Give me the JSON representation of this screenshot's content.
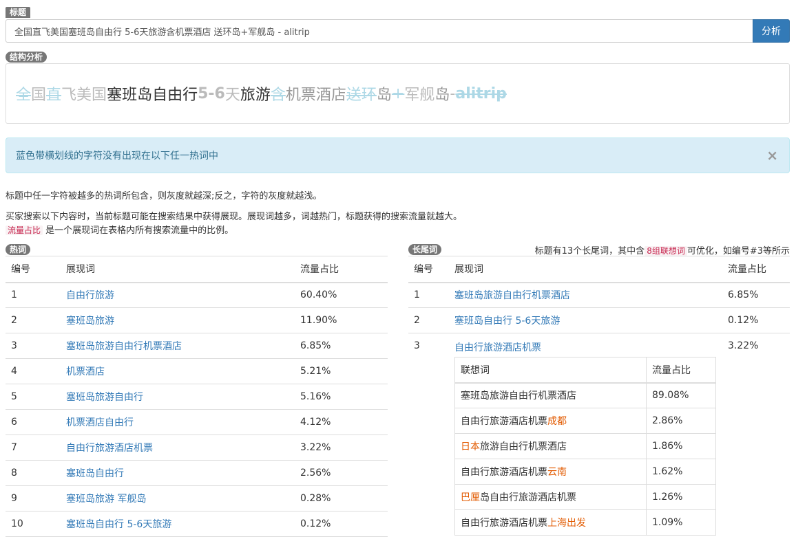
{
  "title_section": {
    "badge": "标题",
    "input_value": "全国直飞美国塞班岛自由行 5-6天旅游含机票酒店 送环岛+军舰岛 - alitrip",
    "analyze_button": "分析"
  },
  "structure": {
    "badge": "结构分析",
    "segments": [
      {
        "text": "全",
        "style": "s"
      },
      {
        "text": "国",
        "style": "g1"
      },
      {
        "text": "直",
        "style": "s"
      },
      {
        "text": "飞美国",
        "style": "g1"
      },
      {
        "text": "塞班岛自由行",
        "style": "g3"
      },
      {
        "text": " 5-6",
        "style": "g1 bold"
      },
      {
        "text": "天",
        "style": "g1"
      },
      {
        "text": "旅游",
        "style": "g3"
      },
      {
        "text": "含",
        "style": "s"
      },
      {
        "text": "机票酒店",
        "style": "g2"
      },
      {
        "text": " 送环",
        "style": "s"
      },
      {
        "text": "岛",
        "style": "g2"
      },
      {
        "text": "+",
        "style": "s"
      },
      {
        "text": "军舰",
        "style": "g1"
      },
      {
        "text": "岛",
        "style": "g2"
      },
      {
        "text": " - ",
        "style": "g1"
      },
      {
        "text": "alitrip",
        "style": "s bold"
      }
    ]
  },
  "alert": {
    "text": "蓝色带横划线的字符没有出现在以下任一热词中",
    "close": "×"
  },
  "info": {
    "line1": "标题中任一字符被越多的热词所包含，则灰度就越深;反之，字符的灰度就越浅。",
    "line2": "买家搜索以下内容时，当前标题可能在搜索结果中获得展现。展现词越多，词越热门，标题获得的搜索流量就越大。",
    "line3_tag": "流量占比",
    "line3_rest": " 是一个展现词在表格内所有搜索流量中的比例。"
  },
  "hot_words": {
    "badge": "热词",
    "headers": [
      "编号",
      "展现词",
      "流量占比"
    ],
    "rows": [
      {
        "no": "1",
        "word": "自由行旅游",
        "ratio": "60.40%"
      },
      {
        "no": "2",
        "word": "塞班岛旅游",
        "ratio": "11.90%"
      },
      {
        "no": "3",
        "word": "塞班岛旅游自由行机票酒店",
        "ratio": "6.85%"
      },
      {
        "no": "4",
        "word": "机票酒店",
        "ratio": "5.21%"
      },
      {
        "no": "5",
        "word": "塞班岛旅游自由行",
        "ratio": "5.16%"
      },
      {
        "no": "6",
        "word": "机票酒店自由行",
        "ratio": "4.12%"
      },
      {
        "no": "7",
        "word": "自由行旅游酒店机票",
        "ratio": "3.22%"
      },
      {
        "no": "8",
        "word": "塞班岛自由行",
        "ratio": "2.56%"
      },
      {
        "no": "9",
        "word": "塞班岛旅游 军舰岛",
        "ratio": "0.28%"
      },
      {
        "no": "10",
        "word": "塞班岛自由行 5-6天旅游",
        "ratio": "0.12%"
      }
    ]
  },
  "long_tail": {
    "badge": "长尾词",
    "summary_pre": "标题有13个长尾词，其中含",
    "summary_tag": "8组联想词",
    "summary_post": "可优化，如编号#3等所示",
    "headers": [
      "编号",
      "展现词",
      "流量占比"
    ],
    "rows": [
      {
        "no": "1",
        "word": "塞班岛旅游自由行机票酒店",
        "ratio": "6.85%"
      },
      {
        "no": "2",
        "word": "塞班岛自由行 5-6天旅游",
        "ratio": "0.12%"
      },
      {
        "no": "3",
        "word": "自由行旅游酒店机票",
        "ratio": "3.22%"
      }
    ],
    "assoc_headers": [
      "联想词",
      "流量占比"
    ],
    "assoc_rows": [
      {
        "pre": "塞班岛旅游自由行机票酒店",
        "hl": "",
        "post": "",
        "ratio": "89.08%"
      },
      {
        "pre": "自由行旅游酒店机票",
        "hl": "成都",
        "post": "",
        "ratio": "2.86%"
      },
      {
        "pre": "",
        "hl": "日本",
        "post": "旅游自由行机票酒店",
        "ratio": "1.86%"
      },
      {
        "pre": "自由行旅游酒店机票",
        "hl": "云南",
        "post": "",
        "ratio": "1.62%"
      },
      {
        "pre": "",
        "hl": "巴厘",
        "post": "岛自由行旅游酒店机票",
        "ratio": "1.26%"
      },
      {
        "pre": "自由行旅游酒店机票",
        "hl": "上海出发",
        "post": "",
        "ratio": "1.09%"
      }
    ]
  }
}
